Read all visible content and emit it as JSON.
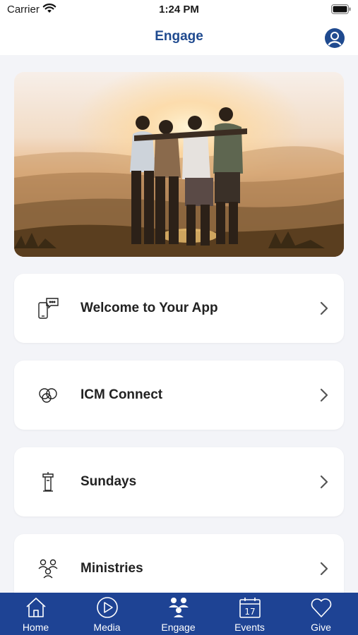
{
  "status_bar": {
    "carrier": "Carrier",
    "time": "1:24 PM"
  },
  "header": {
    "title": "Engage",
    "profile_icon": "person-circle-icon"
  },
  "hero": {
    "image": "group-of-friends-at-sunset-photo"
  },
  "cards": [
    {
      "label": "Welcome to Your App",
      "icon": "phone-chat-icon"
    },
    {
      "label": "ICM Connect",
      "icon": "connect-circles-icon"
    },
    {
      "label": "Sundays",
      "icon": "lectern-icon"
    },
    {
      "label": "Ministries",
      "icon": "people-group-icon"
    }
  ],
  "tab_bar": {
    "tabs": [
      {
        "label": "Home",
        "icon": "home-icon"
      },
      {
        "label": "Media",
        "icon": "play-circle-icon"
      },
      {
        "label": "Engage",
        "icon": "people-group-icon"
      },
      {
        "label": "Events",
        "icon": "calendar-icon",
        "calendar_day": "17"
      },
      {
        "label": "Give",
        "icon": "heart-icon"
      }
    ],
    "selected": "Engage"
  },
  "colors": {
    "accent": "#1f4a8f",
    "tab_bar": "#1e4394",
    "background": "#f3f4f8"
  }
}
